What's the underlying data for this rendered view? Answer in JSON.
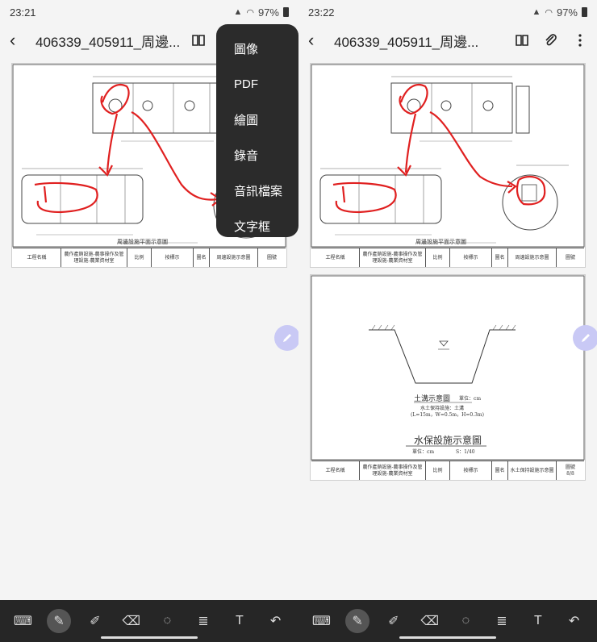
{
  "left": {
    "status": {
      "time": "23:21",
      "battery": "97%"
    },
    "header": {
      "title": "406339_405911_周邊..."
    },
    "menu": {
      "items": [
        "圖像",
        "PDF",
        "繪圖",
        "錄音",
        "音訊檔案",
        "文字框"
      ]
    },
    "page1": {
      "caption": "周邊設施平面示意圖",
      "titleblock": {
        "project_label": "工程名稱",
        "project": "農作產銷設施-農事操作及管理設施-農業資材室",
        "scale_label": "比例",
        "scale": "按標示",
        "sheet_label": "圖名",
        "sheet": "周邊設施示意圖",
        "no_label": "圖號"
      }
    }
  },
  "right": {
    "status": {
      "time": "23:22",
      "battery": "97%"
    },
    "header": {
      "title": "406339_405911_周邊..."
    },
    "page1": {
      "caption": "周邊設施平面示意圖",
      "titleblock": {
        "project_label": "工程名稱",
        "project": "農作產銷設施-農事操作及管理設施-農業資材室",
        "scale_label": "比例",
        "scale": "按標示",
        "sheet_label": "圖名",
        "sheet": "周邊設施示意圖",
        "no_label": "圖號"
      }
    },
    "page2": {
      "ditch_title": "土溝示意圖",
      "ditch_unit": "單位：cm",
      "ditch_note1": "水土保持設施：土溝",
      "ditch_note2": "(L=15m，W=0.5m，H=0.3m)",
      "main_title": "水保設施示意圖",
      "main_unit": "單位：cm",
      "main_scale": "S：1/40",
      "titleblock": {
        "project_label": "工程名稱",
        "project": "農作產銷設施-農事操作及管理設施-農業資材室",
        "scale_label": "比例",
        "scale": "按標示",
        "sheet_label": "圖名",
        "sheet": "水土保持設施示意圖",
        "no_label": "圖號",
        "no": "8/8"
      }
    }
  },
  "colors": {
    "annotation": "#e02020",
    "menu_bg": "#2b2b2b",
    "toolbar_bg": "#262626",
    "fab": "#c9c9f5"
  },
  "toolbar": {
    "icons": [
      "keyboard-icon",
      "pen-icon",
      "highlighter-icon",
      "eraser-icon",
      "lasso-icon",
      "text-format-icon",
      "text-box-icon",
      "undo-icon"
    ]
  }
}
